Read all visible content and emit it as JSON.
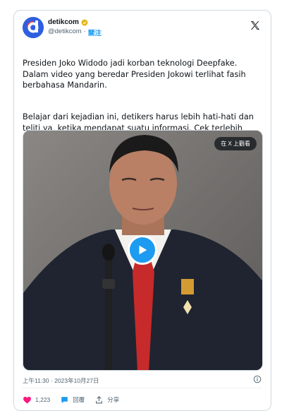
{
  "account": {
    "name": "detikcom",
    "handle": "@detikcom",
    "separator": "·",
    "follow_label": "關注"
  },
  "tweet": {
    "paragraph1": "Presiden Joko Widodo jadi korban teknologi Deepfake. Dalam video yang beredar Presiden Jokowi terlihat fasih berbahasa Mandarin.",
    "paragraph2": "Belajar dari kejadian ini, detikers harus lebih hati-hati dan teliti ya, ketika mendapat suatu informasi. Cek terlebih dahulu keabsahannya."
  },
  "media": {
    "watch_label": "在 X 上觀看",
    "play_icon": "play-icon"
  },
  "meta": {
    "timestamp": "上午11:30 · 2023年10月27日"
  },
  "actions": {
    "likes_count": "1,223",
    "reply_label": "回覆",
    "share_label": "分享"
  },
  "colors": {
    "accent": "#1d9bf0",
    "like": "#f91880",
    "text": "#0f1419",
    "muted": "#536471"
  }
}
